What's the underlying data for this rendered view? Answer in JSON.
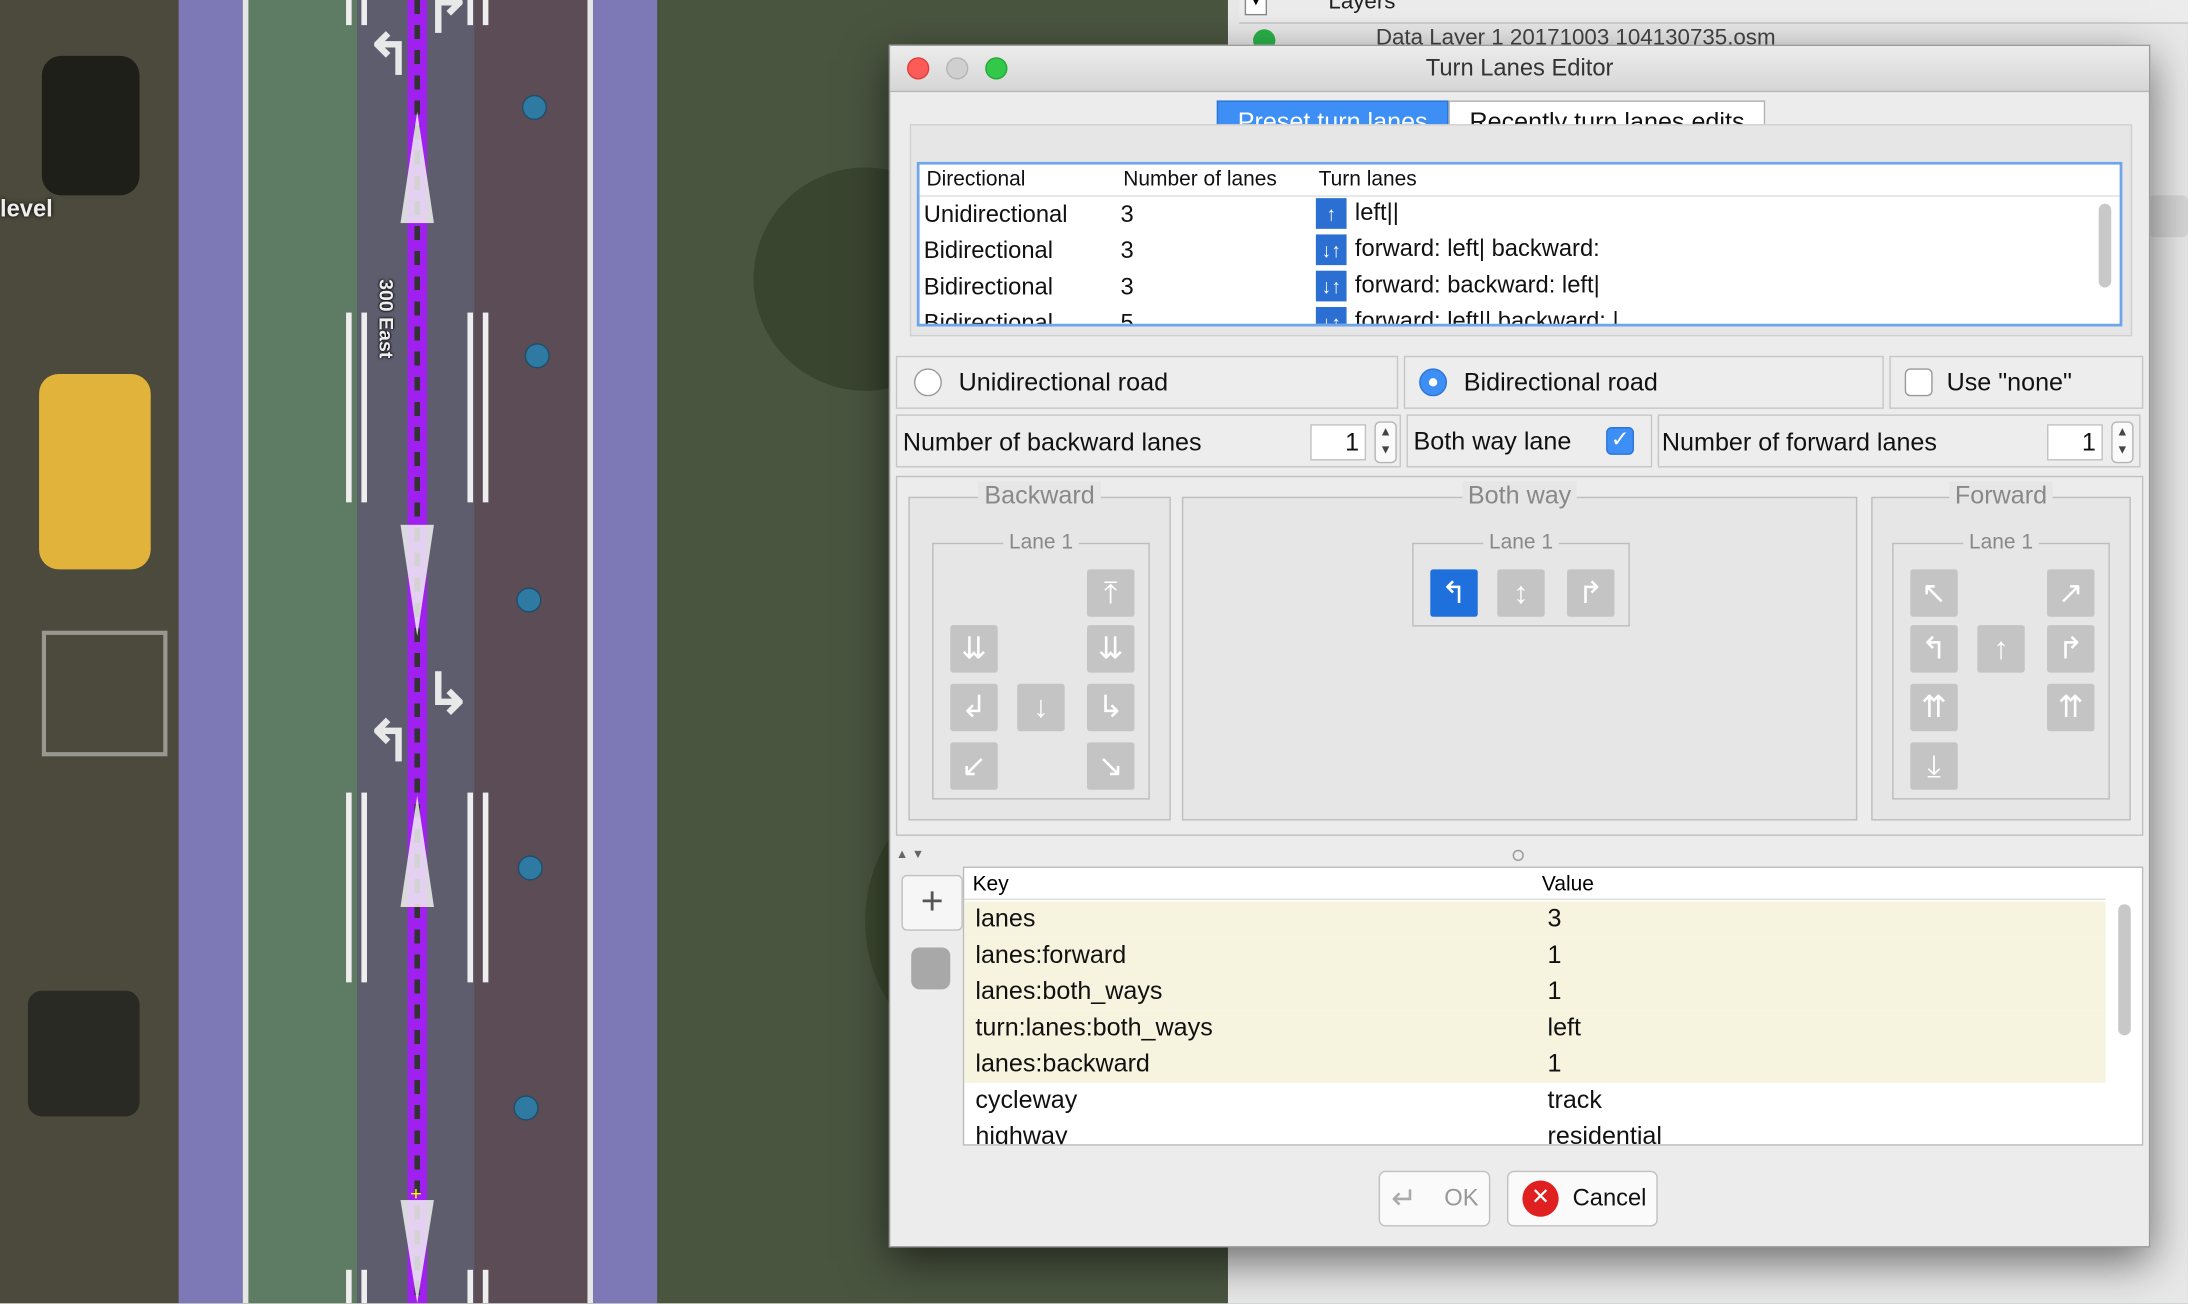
{
  "map": {
    "street_name": "300 East",
    "side_label": "level"
  },
  "background_panel": {
    "layers_title": "Layers",
    "layer_name": "Data Layer 1 20171003 104130735.osm"
  },
  "dialog": {
    "title": "Turn Lanes Editor",
    "tabs": [
      {
        "label": "Preset turn lanes",
        "active": true
      },
      {
        "label": "Recently turn lanes edits",
        "active": false
      }
    ],
    "preset_table": {
      "columns": [
        "Directional",
        "Number of lanes",
        "Turn lanes"
      ],
      "rows": [
        {
          "directional": "Unidirectional",
          "lanes": "3",
          "turn_lanes": "left||"
        },
        {
          "directional": "Bidirectional",
          "lanes": "3",
          "turn_lanes": "forward: left| backward:"
        },
        {
          "directional": "Bidirectional",
          "lanes": "3",
          "turn_lanes": "forward:  backward: left|"
        },
        {
          "directional": "Bidirectional",
          "lanes": "5",
          "turn_lanes": "forward: left|| backward: |"
        }
      ]
    },
    "road_type": {
      "unidirectional_label": "Unidirectional road",
      "bidirectional_label": "Bidirectional road",
      "use_none_label": "Use \"none\"",
      "selected": "bidirectional"
    },
    "lane_counts": {
      "backward_label": "Number of backward lanes",
      "backward_value": "1",
      "both_way_label": "Both way lane",
      "both_way_checked": true,
      "forward_label": "Number of forward lanes",
      "forward_value": "1"
    },
    "groups": {
      "backward_title": "Backward",
      "both_way_title": "Both way",
      "forward_title": "Forward",
      "lane_title": "Lane 1"
    },
    "tags": {
      "columns": [
        "Key",
        "Value"
      ],
      "rows": [
        {
          "key": "lanes",
          "value": "3"
        },
        {
          "key": "lanes:forward",
          "value": "1"
        },
        {
          "key": "lanes:both_ways",
          "value": "1"
        },
        {
          "key": "turn:lanes:both_ways",
          "value": "left"
        },
        {
          "key": "lanes:backward",
          "value": "1"
        },
        {
          "key": "cycleway",
          "value": "track"
        },
        {
          "key": "highway",
          "value": "residential"
        }
      ]
    },
    "buttons": {
      "ok": "OK",
      "cancel": "Cancel"
    }
  },
  "colors": {
    "accent": "#3d8ef5",
    "way_purple": "#a020f0",
    "highlight_row": "#f6f4df",
    "close_red": "#fc5b57",
    "min_gray": "#cfcfcf",
    "max_green": "#34c84a"
  }
}
